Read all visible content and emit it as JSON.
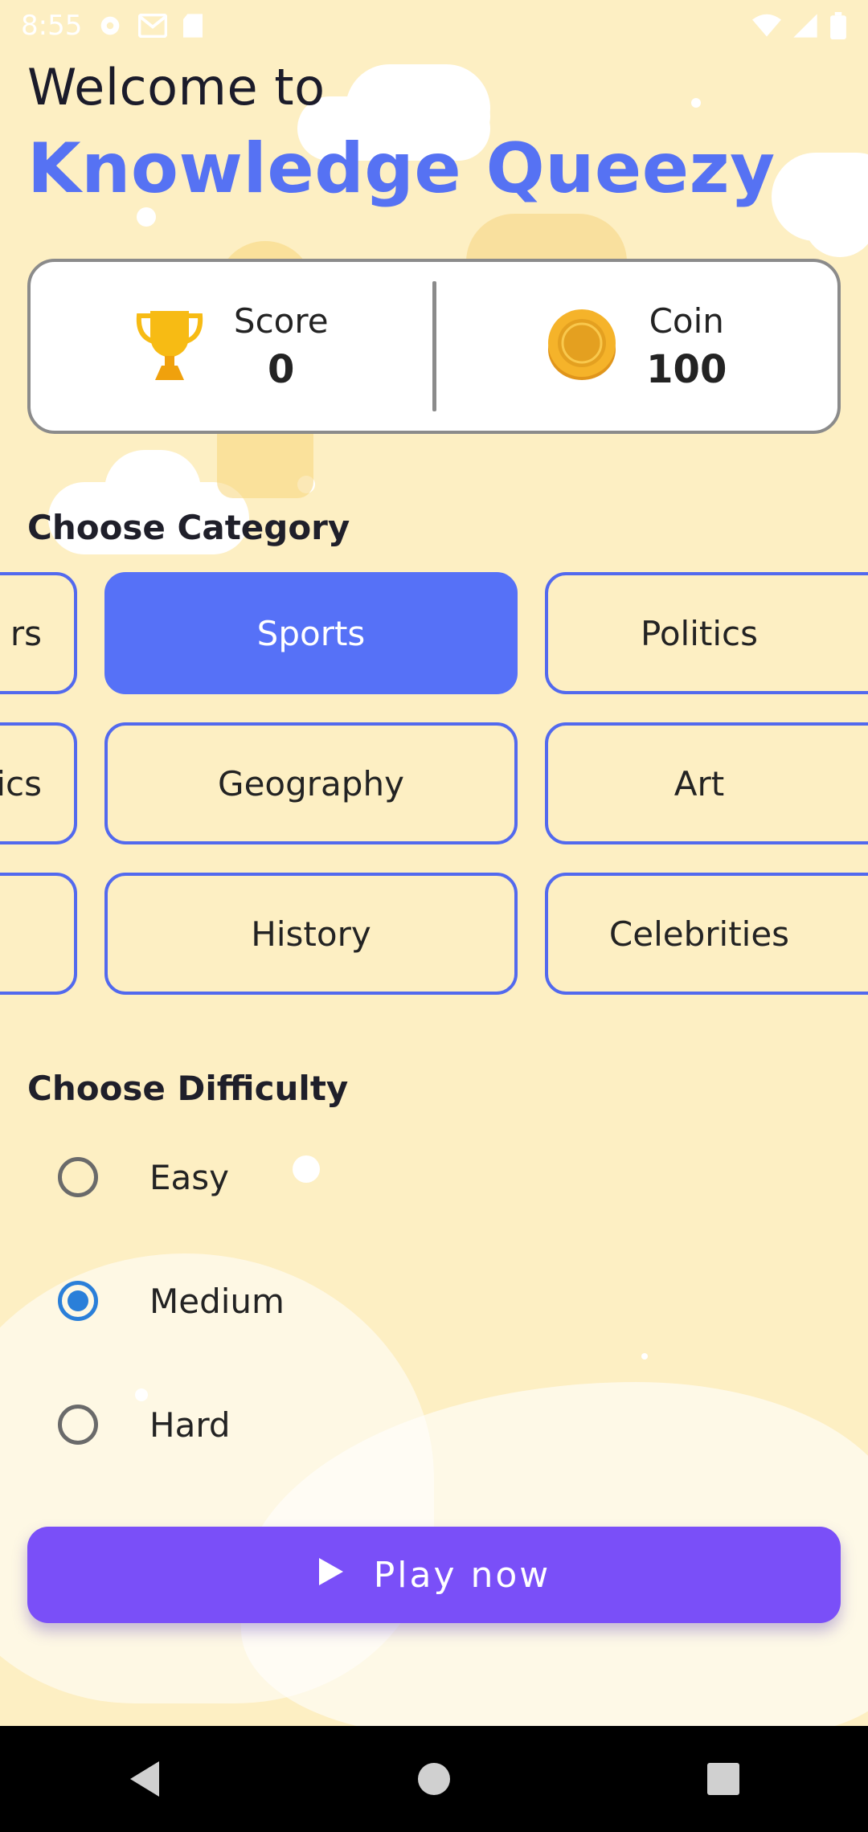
{
  "status_bar": {
    "time": "8:55",
    "icons": [
      "settings-icon",
      "gmail-icon",
      "sd-card-icon",
      "wifi-icon",
      "signal-icon",
      "battery-icon"
    ]
  },
  "header": {
    "welcome_text": "Welcome to",
    "app_name": "Knowledge Queezy"
  },
  "stats": {
    "score_label": "Score",
    "score_value": "0",
    "coin_label": "Coin",
    "coin_value": "100",
    "icons": [
      "trophy-icon",
      "coin-icon"
    ]
  },
  "category": {
    "title": "Choose Category",
    "rows": [
      [
        "rs",
        "Sports",
        "Politics"
      ],
      [
        "tics",
        "Geography",
        "Art"
      ],
      [
        "",
        "History",
        "Celebrities"
      ]
    ],
    "selected": "Sports"
  },
  "difficulty": {
    "title": "Choose Difficulty",
    "options": [
      "Easy",
      "Medium",
      "Hard"
    ],
    "selected": "Medium"
  },
  "play_button": {
    "label": "Play now",
    "icon": "play-icon"
  },
  "nav": {
    "icons": [
      "back-icon",
      "home-icon",
      "recents-icon"
    ]
  },
  "colors": {
    "background": "#fdefc3",
    "accent_blue": "#5672f3",
    "play_purple": "#7a4ff8",
    "radio_checked": "#2a7fd9"
  }
}
